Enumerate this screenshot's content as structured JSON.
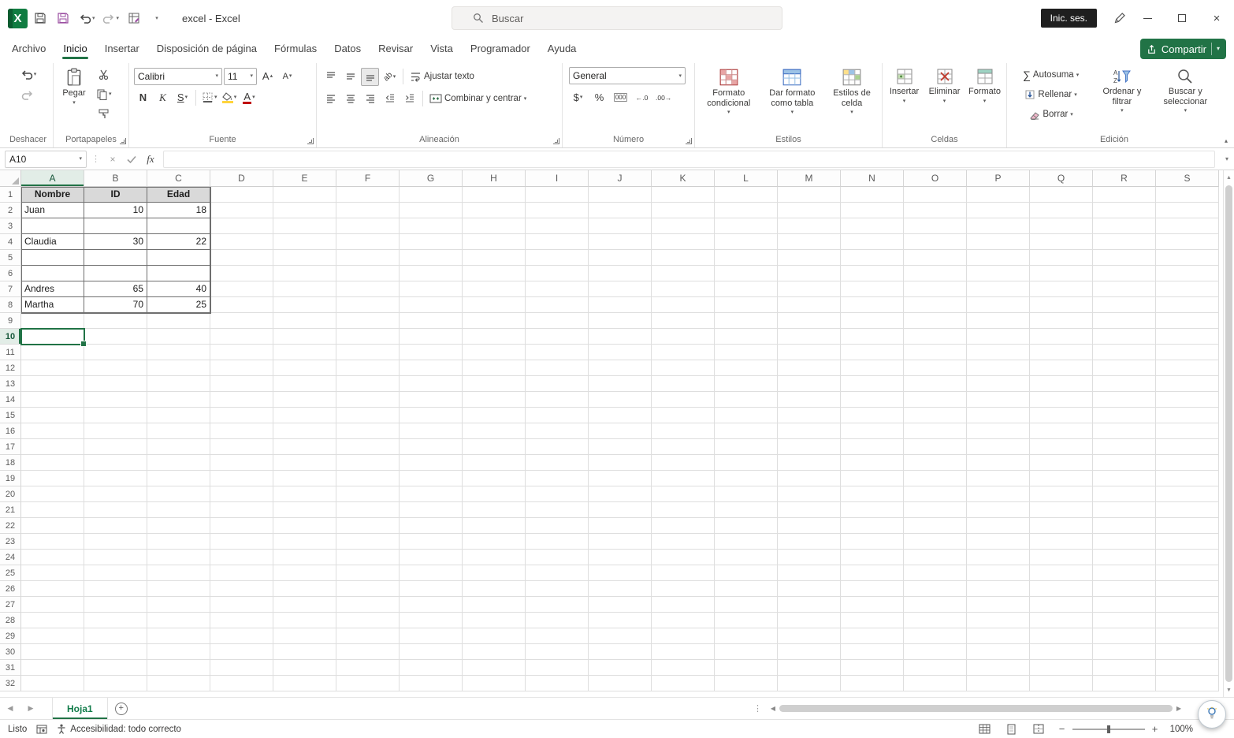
{
  "titlebar": {
    "title": "excel  -  Excel",
    "search_placeholder": "Buscar",
    "signin": "Inic. ses."
  },
  "tabs": {
    "items": [
      {
        "label": "Archivo"
      },
      {
        "label": "Inicio"
      },
      {
        "label": "Insertar"
      },
      {
        "label": "Disposición de página"
      },
      {
        "label": "Fórmulas"
      },
      {
        "label": "Datos"
      },
      {
        "label": "Revisar"
      },
      {
        "label": "Vista"
      },
      {
        "label": "Programador"
      },
      {
        "label": "Ayuda"
      }
    ],
    "active_tab": "Inicio",
    "share": "Compartir"
  },
  "ribbon": {
    "groups": {
      "deshacer": "Deshacer",
      "portapapeles": "Portapapeles",
      "fuente": "Fuente",
      "alineacion": "Alineación",
      "numero": "Número",
      "estilos": "Estilos",
      "celdas": "Celdas",
      "edicion": "Edición"
    },
    "portapapeles": {
      "pegar": "Pegar"
    },
    "fuente": {
      "font_name": "Calibri",
      "font_size": "11",
      "bold": "N",
      "italic": "K",
      "underline": "S"
    },
    "alineacion": {
      "wrap": "Ajustar texto",
      "merge": "Combinar y centrar"
    },
    "numero": {
      "format": "General",
      "currency": "$",
      "percent": "%",
      "thousands": "000"
    },
    "estilos": {
      "conditional": "Formato condicional",
      "as_table": "Dar formato como tabla",
      "cell_styles": "Estilos de celda"
    },
    "celdas": {
      "insert": "Insertar",
      "remove": "Eliminar",
      "format": "Formato"
    },
    "edicion": {
      "autosum": "Autosuma",
      "fill": "Rellenar",
      "clear": "Borrar",
      "sort": "Ordenar y filtrar",
      "find": "Buscar y seleccionar"
    }
  },
  "formula_bar": {
    "name_box": "A10",
    "fx": "fx",
    "formula": ""
  },
  "grid": {
    "columns": [
      "A",
      "B",
      "C",
      "D",
      "E",
      "F",
      "G",
      "H",
      "I",
      "J",
      "K",
      "L",
      "M",
      "N",
      "O",
      "P",
      "Q",
      "R",
      "S"
    ],
    "row_count": 32,
    "selected": {
      "col": "A",
      "row": 10
    },
    "table_range": {
      "cols": 3,
      "rows": 8
    },
    "cells": {
      "A1": {
        "v": "Nombre",
        "h": 1
      },
      "B1": {
        "v": "ID",
        "h": 1
      },
      "C1": {
        "v": "Edad",
        "h": 1
      },
      "A2": {
        "v": "Juan"
      },
      "B2": {
        "v": "10",
        "n": 1
      },
      "C2": {
        "v": "18",
        "n": 1
      },
      "A4": {
        "v": "Claudia"
      },
      "B4": {
        "v": "30",
        "n": 1
      },
      "C4": {
        "v": "22",
        "n": 1
      },
      "A7": {
        "v": "Andres"
      },
      "B7": {
        "v": "65",
        "n": 1
      },
      "C7": {
        "v": "40",
        "n": 1
      },
      "A8": {
        "v": "Martha"
      },
      "B8": {
        "v": "70",
        "n": 1
      },
      "C8": {
        "v": "25",
        "n": 1
      }
    }
  },
  "sheet_bar": {
    "tab": "Hoja1"
  },
  "status_bar": {
    "ready": "Listo",
    "accessibility": "Accesibilidad: todo correcto",
    "zoom": "100%"
  },
  "colors": {
    "accent_green": "#217346",
    "table_header_fill": "#d9d9d9",
    "font_color_red": "#c00000",
    "fill_color_yellow": "#ffd43b"
  }
}
